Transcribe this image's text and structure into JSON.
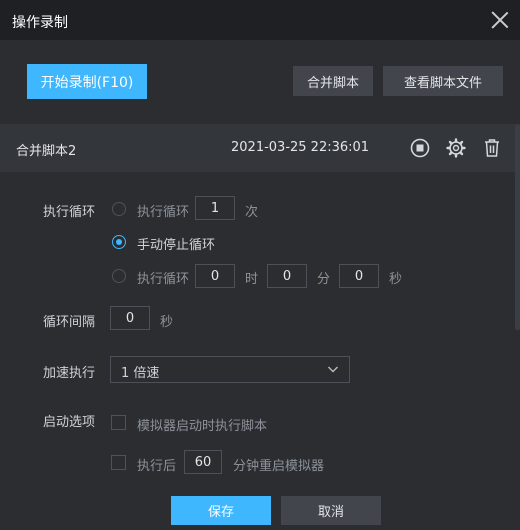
{
  "window": {
    "title": "操作录制"
  },
  "toolbar": {
    "start_record_label": "开始录制(F10)",
    "merge_script_label": "合并脚本",
    "view_files_label": "查看脚本文件"
  },
  "script": {
    "name": "合并脚本2",
    "time": "2021-03-25 22:36:01"
  },
  "loop": {
    "label": "执行循环",
    "option_count_label": "执行循环",
    "count_value": "1",
    "count_unit": "次",
    "option_manual_label": "手动停止循环",
    "option_time_label": "执行循环",
    "hours_value": "0",
    "hours_unit": "时",
    "minutes_value": "0",
    "minutes_unit": "分",
    "seconds_value": "0",
    "seconds_unit": "秒",
    "selected": "manual"
  },
  "interval": {
    "label": "循环间隔",
    "value": "0",
    "unit": "秒"
  },
  "speed": {
    "label": "加速执行",
    "value": "1 倍速"
  },
  "startup": {
    "label": "启动选项",
    "option_run_on_start": "模拟器启动时执行脚本",
    "option_restart_prefix": "执行后",
    "restart_minutes": "60",
    "option_restart_suffix": "分钟重启模拟器"
  },
  "footer": {
    "save_label": "保存",
    "cancel_label": "取消"
  },
  "colors": {
    "accent": "#3fb7ff",
    "background": "#2b2d31",
    "titlebar": "#1f2023"
  }
}
